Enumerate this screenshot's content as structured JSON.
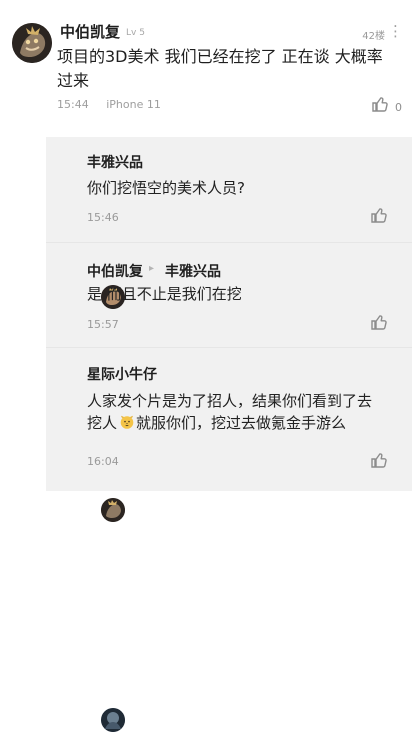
{
  "main_comment": {
    "username": "中伯凯复",
    "level": "Lv 5",
    "floor": "42楼",
    "more_icon": "vertical-ellipsis-icon",
    "content": "项目的3D美术 我们已经在挖了 正在谈 大概率过来",
    "time": "15:44",
    "device": "iPhone 11",
    "like_count": "0",
    "like_icon": "thumbs-up-icon"
  },
  "replies": [
    {
      "username": "丰雅兴品",
      "content": "你们挖悟空的美术人员?",
      "time": "15:46",
      "like_icon": "thumbs-up-icon"
    },
    {
      "username": "中伯凯复",
      "reply_arrow": "▸",
      "reply_to": "丰雅兴品",
      "content": "是 而且不止是我们在挖",
      "time": "15:57",
      "like_icon": "thumbs-up-icon"
    },
    {
      "username": "星际小牛仔",
      "content_before_emoji": "人家发个片是为了招人，结果你们看到了去挖人",
      "emoji_icon": "dog-face-emoji-icon",
      "content_after_emoji": "就服你们，挖过去做氪金手游么",
      "time": "16:04",
      "like_icon": "thumbs-up-icon"
    }
  ],
  "colors": {
    "background": "#ffffff",
    "reply_panel": "#f1f1f1",
    "primary_text": "#1f1f1f",
    "meta_text": "#9e9e9e",
    "emoji_yellow": "#f4c447"
  }
}
